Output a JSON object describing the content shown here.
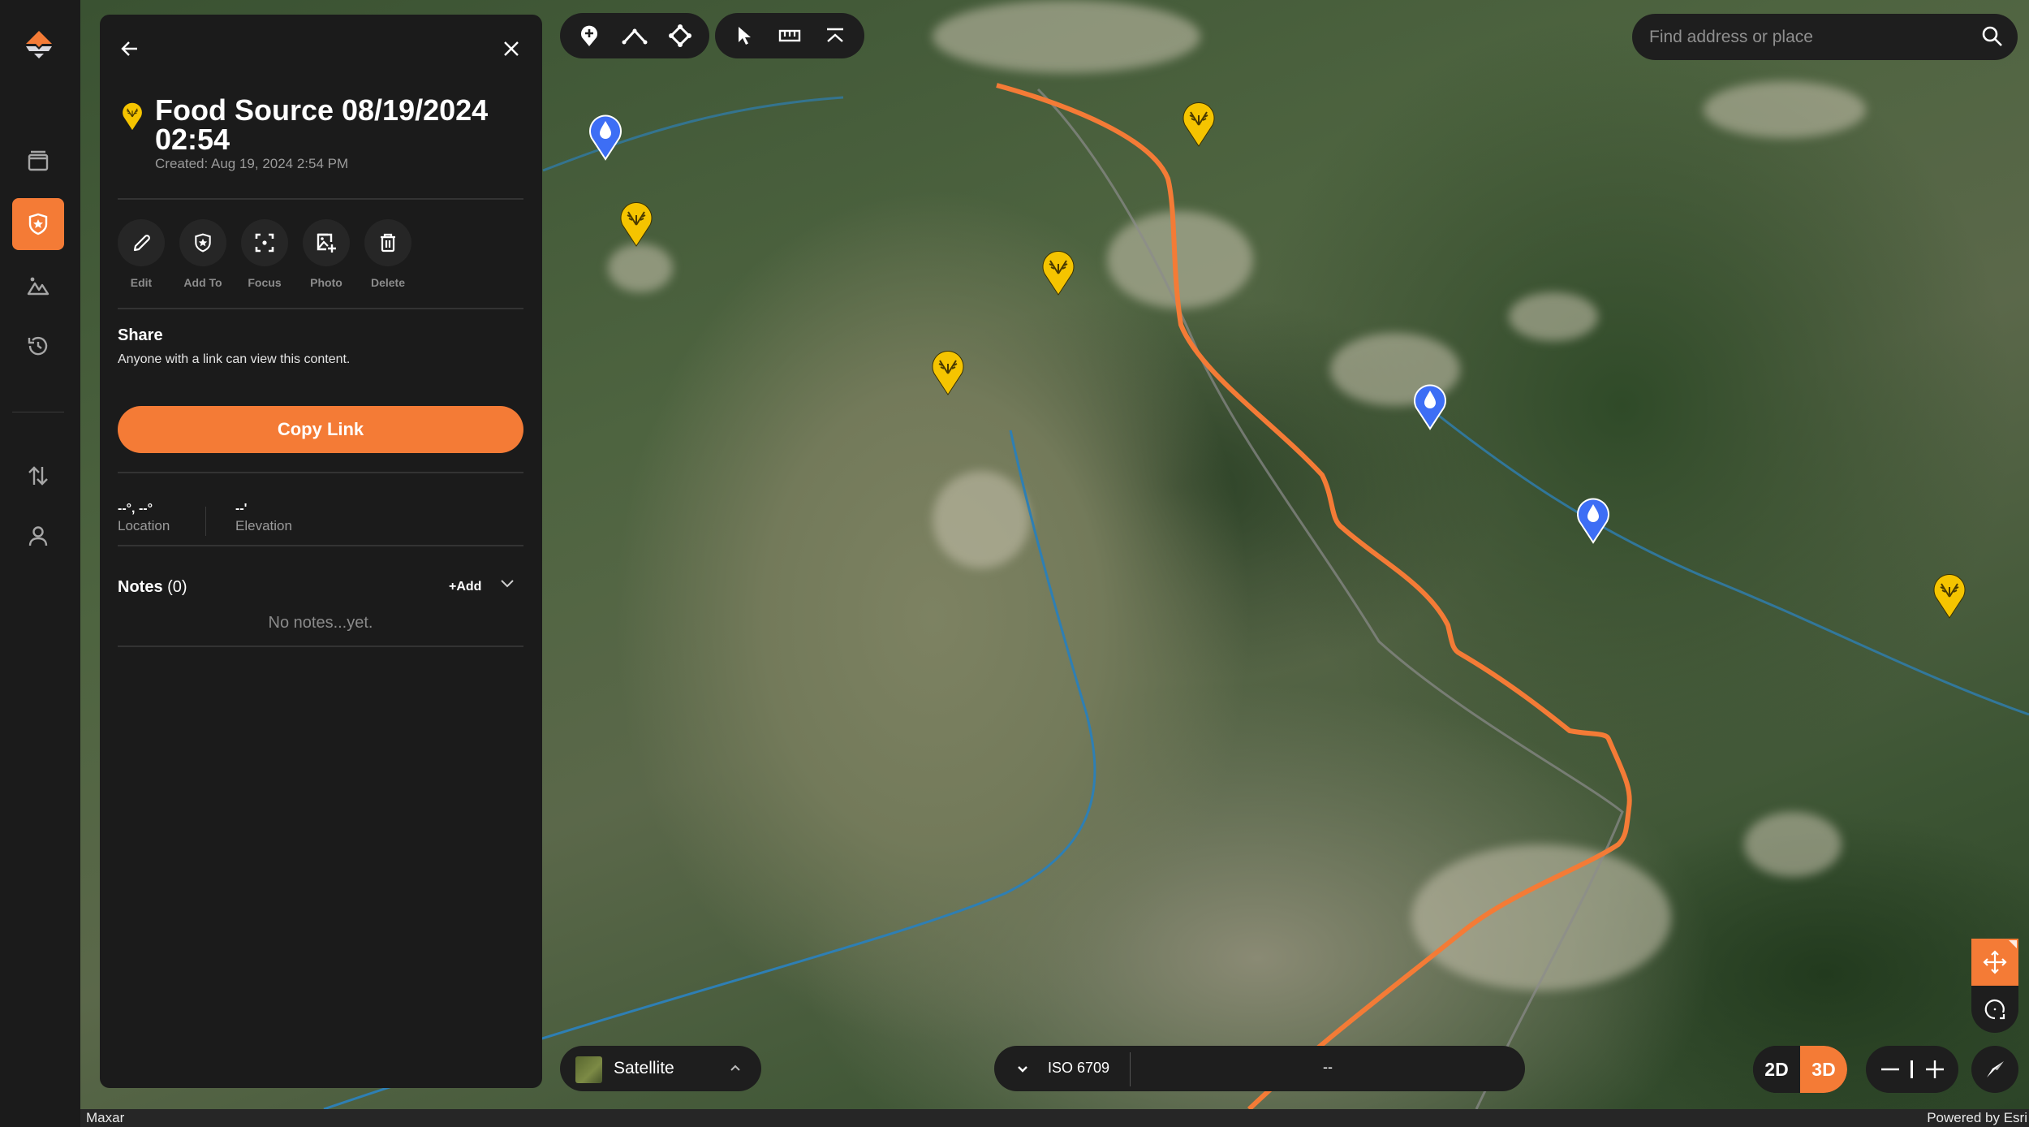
{
  "app": {
    "brand_color": "#f47b36",
    "surface_color": "#1b1b1b"
  },
  "sidebar": {
    "logo": "app-logo",
    "items": [
      {
        "name": "library",
        "icon": "library-icon",
        "active": false
      },
      {
        "name": "markups",
        "icon": "shield-star-icon",
        "active": true
      },
      {
        "name": "terrain",
        "icon": "mountain-icon",
        "active": false
      },
      {
        "name": "history",
        "icon": "history-icon",
        "active": false
      }
    ],
    "bottom_items": [
      {
        "name": "import-export",
        "icon": "sort-arrows-icon"
      },
      {
        "name": "account",
        "icon": "user-icon"
      }
    ]
  },
  "panel": {
    "title": "Food Source 08/19/2024 02:54",
    "created": "Created: Aug 19, 2024 2:54 PM",
    "marker_color": "#f5c400",
    "actions": [
      {
        "label": "Edit",
        "icon": "pencil-icon"
      },
      {
        "label": "Add To",
        "icon": "shield-star-icon"
      },
      {
        "label": "Focus",
        "icon": "focus-icon"
      },
      {
        "label": "Photo",
        "icon": "add-photo-icon"
      },
      {
        "label": "Delete",
        "icon": "trash-icon"
      }
    ],
    "share": {
      "title": "Share",
      "subtitle": "Anyone with a link can view this content.",
      "button": "Copy Link"
    },
    "location": {
      "value": "--°, --°",
      "label": "Location"
    },
    "elevation": {
      "value": "--'",
      "label": "Elevation"
    },
    "notes": {
      "title": "Notes",
      "count": "(0)",
      "add_label": "+Add",
      "empty": "No notes...yet."
    }
  },
  "toolbar": {
    "draw_tools": [
      "add-waypoint-icon",
      "draw-line-icon",
      "draw-shape-icon"
    ],
    "map_tools": [
      "select-pointer-icon",
      "measure-ruler-icon",
      "elevation-profile-icon"
    ]
  },
  "search": {
    "placeholder": "Find address or place"
  },
  "basemap": {
    "label": "Satellite"
  },
  "coordinates": {
    "projection": "ISO 6709",
    "value": "--"
  },
  "view": {
    "mode_2d": "2D",
    "mode_3d": "3D",
    "active": "3D"
  },
  "attribution": {
    "left": "Maxar",
    "right": "Powered by Esri"
  },
  "map": {
    "water_markers": 3,
    "food_source_markers": 5,
    "trail_color": "#f47b36",
    "water_color": "#3d6ef5",
    "food_color": "#f5c400"
  }
}
